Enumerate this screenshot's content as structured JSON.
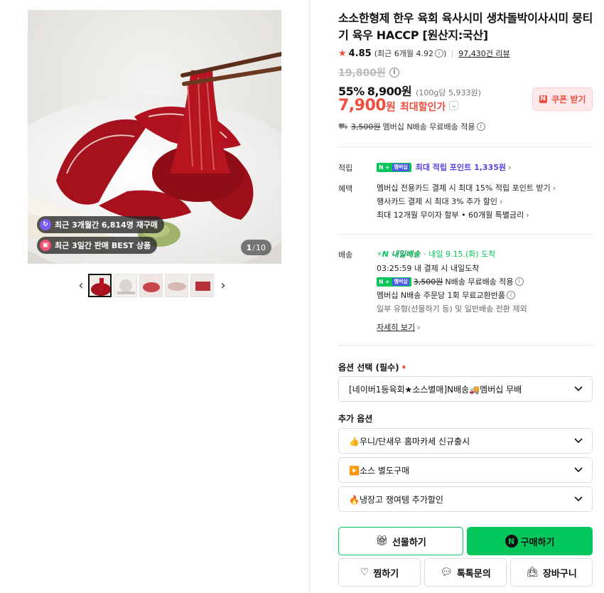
{
  "gallery": {
    "badge_reorder": "최근 3개월간 6,814명 재구매",
    "badge_best": "최근 3일간 판매 BEST 상품",
    "counter_current": "1",
    "counter_total": "10",
    "prev_icon": "chevron-left-icon",
    "next_icon": "chevron-right-icon",
    "thumbnail_count": 5
  },
  "product": {
    "title": "소소한형제 한우 육회 육사시미 생차돌박이사시미 뭉티기 육우 HACCP [원산지:국산]",
    "rating": "4.85",
    "rating_sub": "(최근 6개월 4.92",
    "rating_sub_end": ")",
    "review_count": "97,430건 리뷰",
    "original_price": "19,800원",
    "discount_pct": "55%",
    "sale_price": "8,900원",
    "unit_price": "(100g당 5,933원)",
    "max_discount_price": "7,900",
    "max_discount_won": "원",
    "max_discount_label": "최대할인가",
    "coupon_label": "쿠폰 받기",
    "shipping_fee_strike": "3,500원",
    "shipping_text": "멤버십 N배송 무료배송 적용"
  },
  "benefits": {
    "points_label": "적립",
    "points_text": "최대 적립 포인트 1,335원",
    "benefit_label": "혜택",
    "benefit_lines": [
      "멤버십 전용카드 결제 시 최대 15% 적립 포인트 받기",
      "행사카드 결제 시 최대 3% 추가 할인",
      "최대 12개월 무이자 할부 • 60개월 특별금리"
    ],
    "npay_badge": "N",
    "npay_plus": "+",
    "npay_member": "멤버십"
  },
  "delivery": {
    "label": "배송",
    "tomorrow_label": "내일배송",
    "arrival": "· 내일 9.15.(화) 도착",
    "cutoff": "03:25:59 내 결제 시 내일도착",
    "fee_strike": "3,500원",
    "fee_text": "N배송 무료배송 적용",
    "exchange": "멤버십 N배송 주문당 1회 무료교환반품",
    "exception": "일부 유형(선물하기 등) 및 일반배송 전환 제외",
    "details_link": "자세히 보기"
  },
  "options": {
    "required_title": "옵션 선택 (필수)",
    "required_dot": "•",
    "required_value": "[네이버1등육회★소스별매]N배송🚚멤버십 무배",
    "extra_title": "추가 옵션",
    "extra": [
      "👍우니/단새우 홈마카세 신규출시",
      "▶️소스 별도구매",
      "🔥냉장고 쟁여템 추가할인"
    ]
  },
  "actions": {
    "gift": "선물하기",
    "buy": "구매하기",
    "buy_logo": "N",
    "wish": "찜하기",
    "talk": "톡톡문의",
    "cart": "장바구니"
  },
  "colors": {
    "naver_green": "#03c75a",
    "sale_red": "#f04e3e",
    "points_purple": "#5b3fe0"
  }
}
